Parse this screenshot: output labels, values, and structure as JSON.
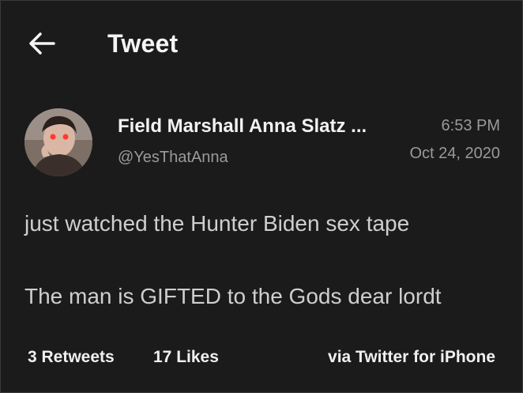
{
  "header": {
    "back_icon": "arrow-left-icon",
    "title": "Tweet"
  },
  "tweet": {
    "author_name": "Field Marshall Anna Slatz ...",
    "author_handle": "@YesThatAnna",
    "time": "6:53 PM",
    "date": "Oct 24, 2020",
    "lines": [
      "just watched the Hunter Biden sex tape",
      "The man is GIFTED to the Gods dear lordt"
    ],
    "retweets": "3 Retweets",
    "likes": "17 Likes",
    "source": "via Twitter for iPhone"
  },
  "colors": {
    "background": "#1b1b1b",
    "text_primary": "#f2f2f2",
    "text_secondary": "#9a9a9a",
    "text_body": "#cfcfcf"
  }
}
